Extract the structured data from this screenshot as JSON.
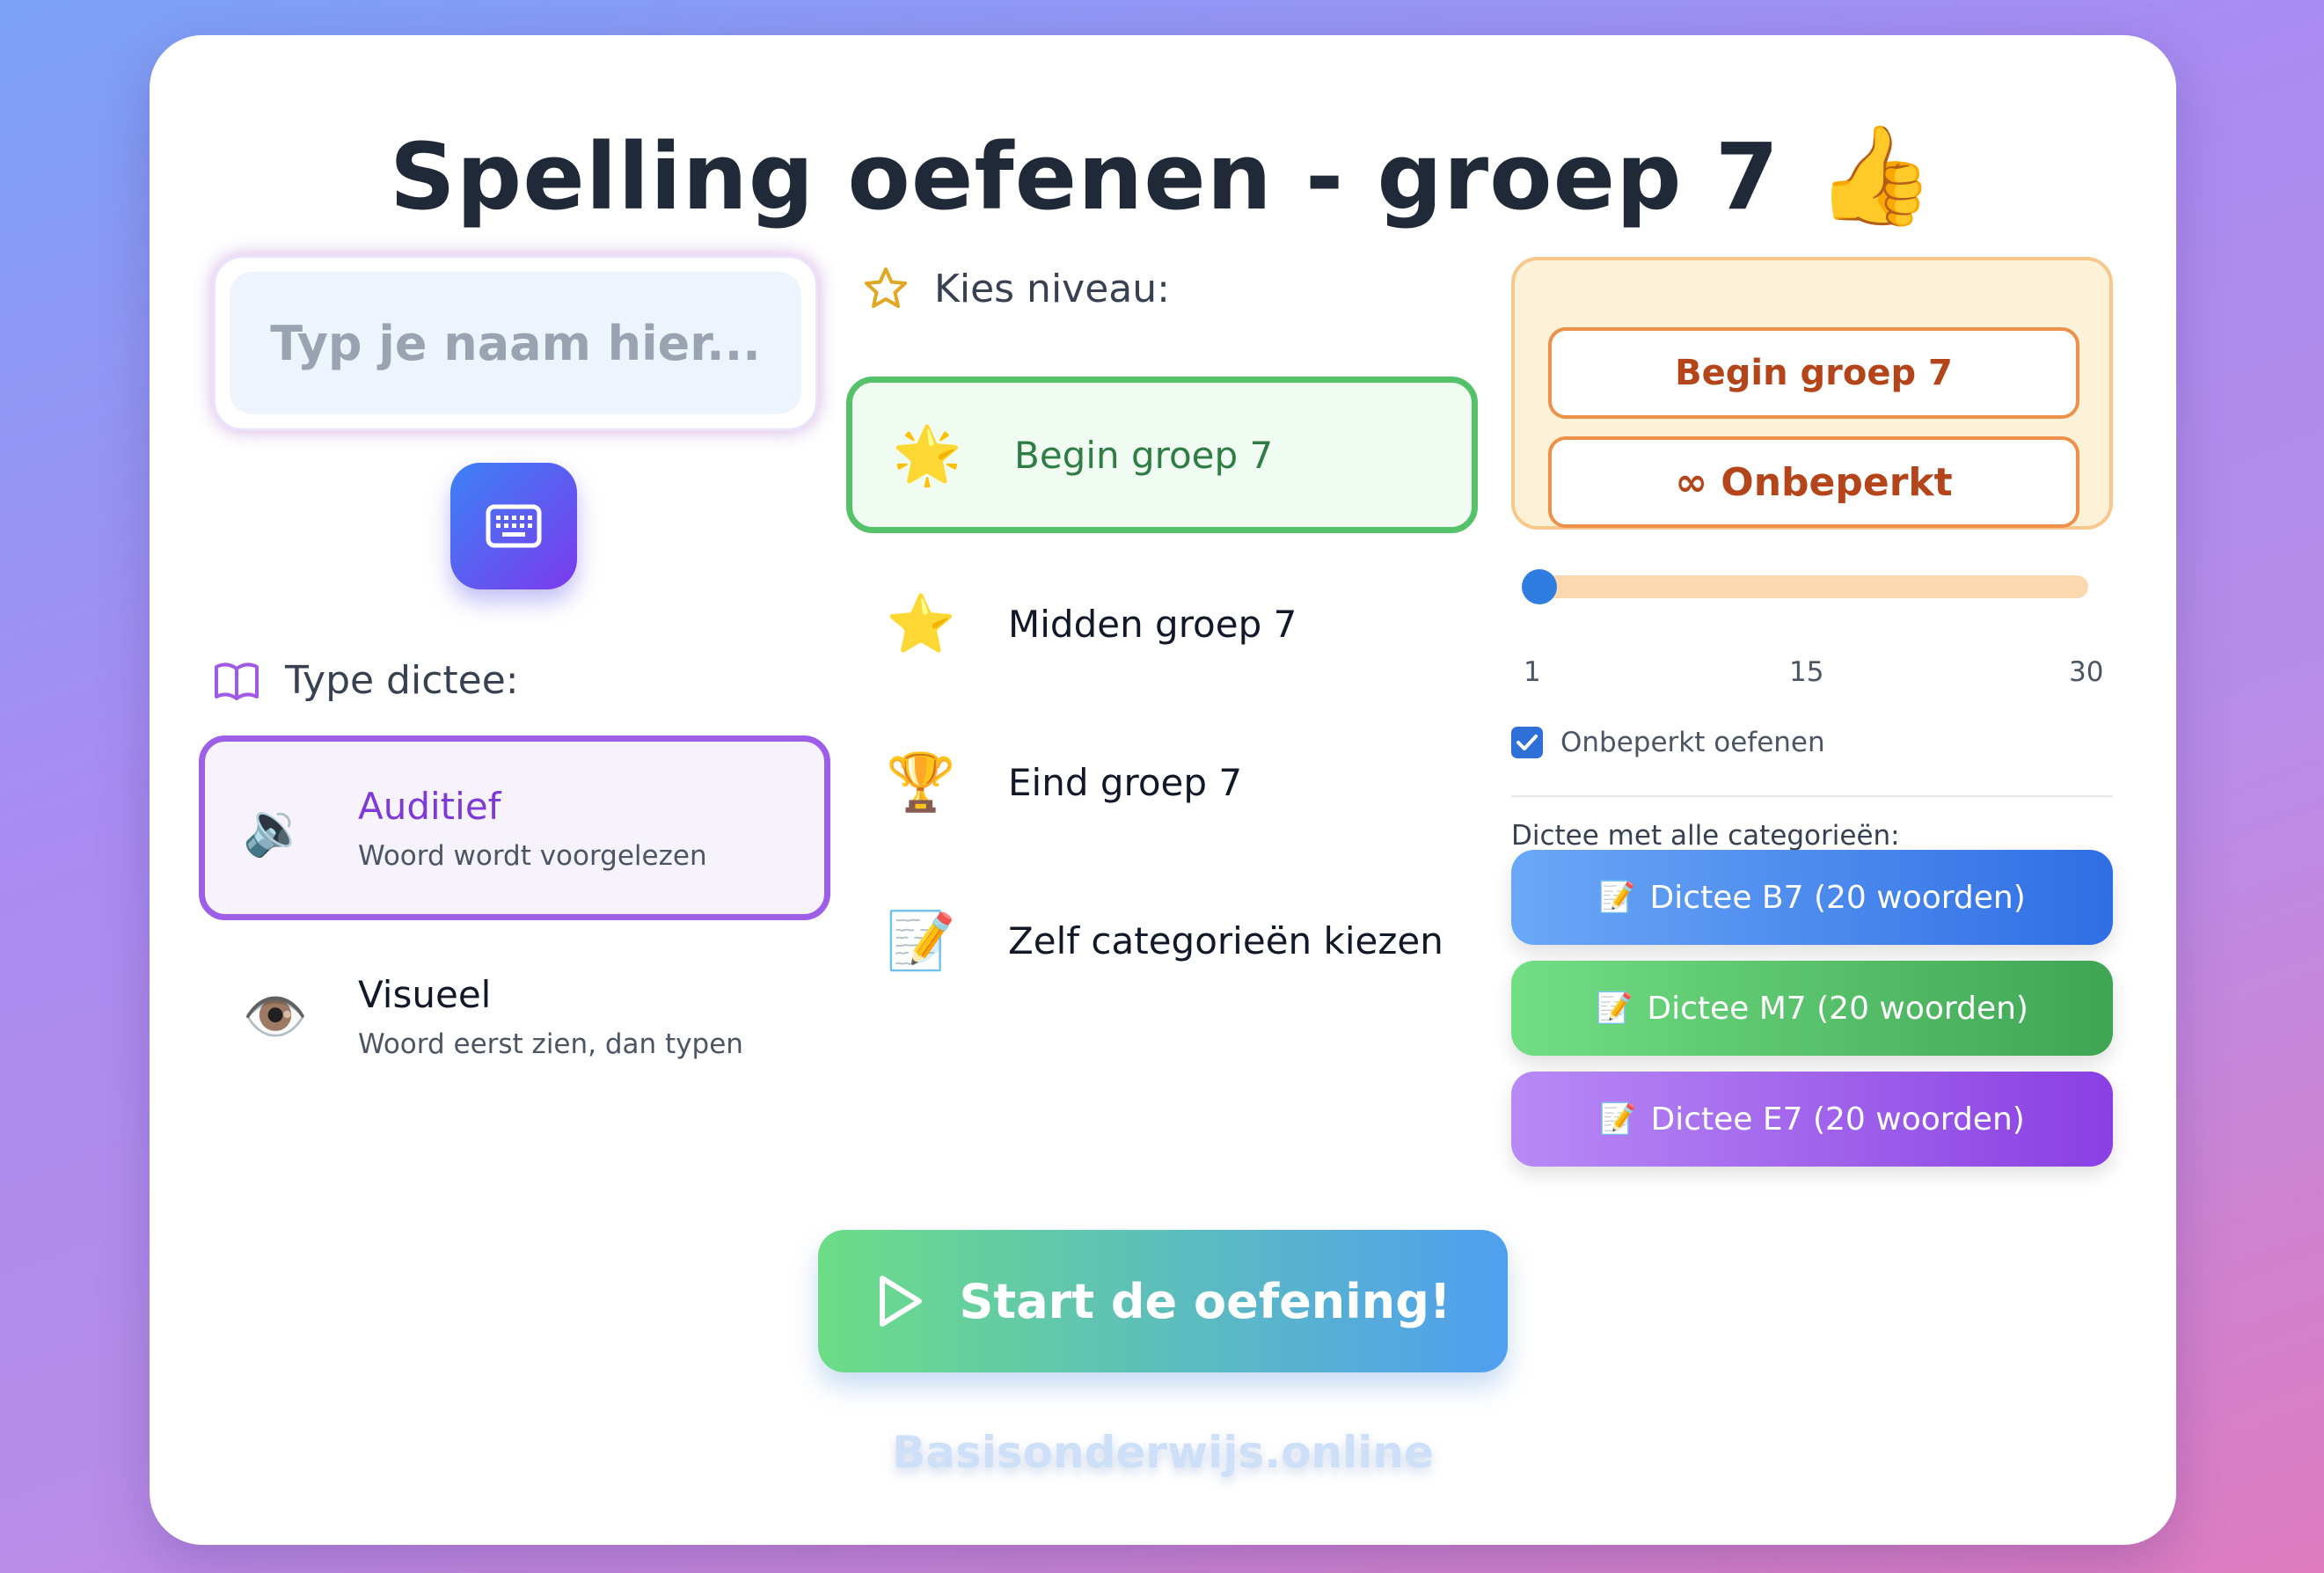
{
  "title": "Spelling oefenen - groep 7",
  "title_emoji": "👍",
  "name_input": {
    "placeholder": "Typ je naam hier..."
  },
  "keyboard_button_icon": "keyboard-icon",
  "dictation_type": {
    "label": "Type dictee:",
    "options": [
      {
        "title": "Auditief",
        "subtitle": "Woord wordt voorgelezen",
        "icon": "🔉",
        "selected": true
      },
      {
        "title": "Visueel",
        "subtitle": "Woord eerst zien, dan typen",
        "icon": "👁️",
        "selected": false
      }
    ]
  },
  "level": {
    "label": "Kies niveau:",
    "options": [
      {
        "label": "Begin groep 7",
        "icon": "🌟",
        "selected": true
      },
      {
        "label": "Midden groep 7",
        "icon": "⭐",
        "selected": false
      },
      {
        "label": "Eind groep 7",
        "icon": "🏆",
        "selected": false
      },
      {
        "label": "Zelf categorieën kiezen",
        "icon": "📝",
        "selected": false
      }
    ]
  },
  "group_summary": {
    "group_label": "Begin groep 7",
    "count_label": "∞ Onbeperkt"
  },
  "word_slider": {
    "min": "1",
    "mid": "15",
    "max": "30",
    "value": 1
  },
  "unlimited_checkbox": {
    "label": "Onbeperkt oefenen",
    "checked": true
  },
  "dictee": {
    "label": "Dictee met alle categorieën:",
    "buttons": [
      {
        "label": "Dictee B7 (20 woorden)",
        "icon": "📝",
        "color_from": "#6aa8f7",
        "color_to": "#2f6ee4"
      },
      {
        "label": "Dictee M7 (20 woorden)",
        "icon": "📝",
        "color_from": "#72de84",
        "color_to": "#3fa553"
      },
      {
        "label": "Dictee E7 (20 woorden)",
        "icon": "📝",
        "color_from": "#b88af5",
        "color_to": "#8a3fe3"
      }
    ]
  },
  "start_button": {
    "label": "Start de oefening!"
  },
  "footer": "Basisonderwijs.online"
}
